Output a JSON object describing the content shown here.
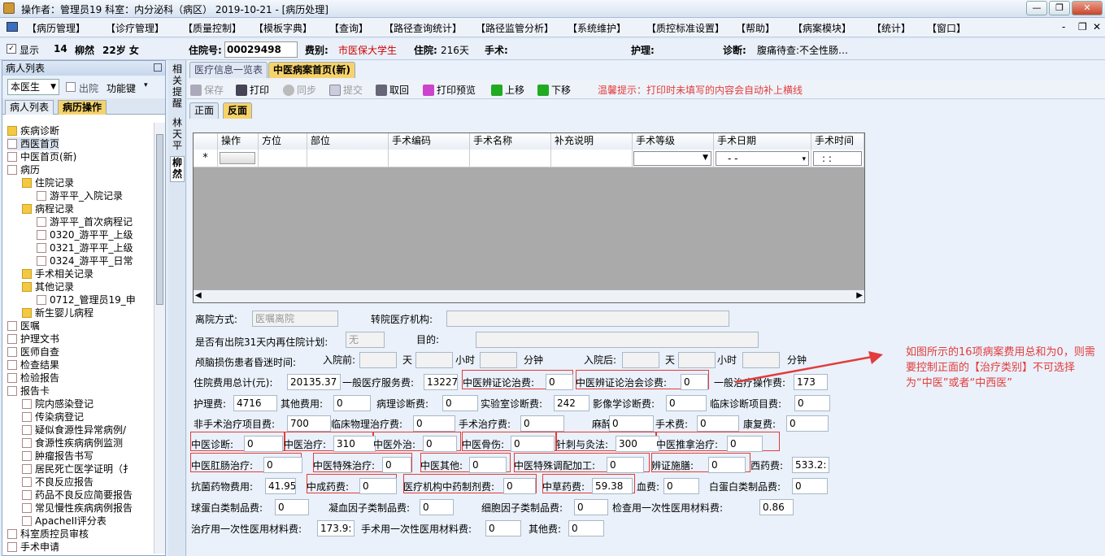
{
  "titlebar": {
    "text": "操作者：管理员19  科室：内分泌科（病区）  2019-10-21 - [病历处理]",
    "minimize": "—",
    "restore": "❐",
    "close": "✕"
  },
  "menu": [
    "【病历管理】",
    "【诊疗管理】",
    "【质量控制】",
    "【模板字典】",
    "【查询】",
    "【路径查询统计】",
    "【路径监管分析】",
    "【系统维护】",
    "【质控标准设置】",
    "【帮助】",
    "【病案模块】",
    "【统计】",
    "【窗口】"
  ],
  "menu_right": {
    "min": "-",
    "restore": "❐",
    "close": "✕"
  },
  "patient": {
    "show_label": "显示",
    "bed": "14",
    "name": "柳然",
    "age_sex": "22岁 女",
    "inpatient_no_label": "住院号:",
    "inpatient_no": "00029498",
    "fee_type_label": "费别:",
    "fee_type": "市医保大学生",
    "stay_label": "住院:",
    "stay": "216天",
    "surgery_label": "手术:",
    "nursing_label": "护理:",
    "diagnosis_label": "诊断:",
    "diagnosis": "腹痛待查:不全性肠…"
  },
  "left_panel": {
    "title": "病人列表",
    "doctor_select": "本医生",
    "discharge_label": "出院",
    "function_key": "功能键",
    "tabs": [
      "病人列表",
      "病历操作"
    ],
    "tree": [
      {
        "label": "疾病诊断",
        "level": 1
      },
      {
        "label": "西医首页",
        "level": 1
      },
      {
        "label": "中医首页(新)",
        "level": 1
      },
      {
        "label": "病历",
        "level": 1
      },
      {
        "label": "住院记录",
        "level": 2
      },
      {
        "label": "游平平_入院记录",
        "level": 3
      },
      {
        "label": "病程记录",
        "level": 2
      },
      {
        "label": "游平平_首次病程记",
        "level": 3
      },
      {
        "label": "0320_游平平_上级",
        "level": 3
      },
      {
        "label": "0321_游平平_上级",
        "level": 3
      },
      {
        "label": "0324_游平平_日常",
        "level": 3
      },
      {
        "label": "手术相关记录",
        "level": 2
      },
      {
        "label": "其他记录",
        "level": 2
      },
      {
        "label": "0712_管理员19_申",
        "level": 3
      },
      {
        "label": "新生婴儿病程",
        "level": 2
      },
      {
        "label": "医嘱",
        "level": 1
      },
      {
        "label": "护理文书",
        "level": 1
      },
      {
        "label": "医师自查",
        "level": 1
      },
      {
        "label": "检查结果",
        "level": 1
      },
      {
        "label": "检验报告",
        "level": 1
      },
      {
        "label": "报告卡",
        "level": 1
      },
      {
        "label": "院内感染登记",
        "level": 2
      },
      {
        "label": "传染病登记",
        "level": 2
      },
      {
        "label": "疑似食源性异常病例/",
        "level": 2
      },
      {
        "label": "食源性疾病病例监测",
        "level": 2
      },
      {
        "label": "肿瘤报告书写",
        "level": 2
      },
      {
        "label": "居民死亡医学证明（扌",
        "level": 2
      },
      {
        "label": "不良反应报告",
        "level": 2
      },
      {
        "label": "药品不良反应简要报告",
        "level": 2
      },
      {
        "label": "常见慢性疾病病例报告",
        "level": 2
      },
      {
        "label": "ApacheII评分表",
        "level": 2
      },
      {
        "label": "科室质控员审核",
        "level": 1
      },
      {
        "label": "手术申请",
        "level": 1
      }
    ]
  },
  "side_strip": [
    "相关提醒",
    "林天平",
    "柳然"
  ],
  "main_tabs": [
    "医疗信息一览表",
    "中医病案首页(新)"
  ],
  "toolbar": {
    "save": "保存",
    "print": "打印",
    "sync": "同步",
    "submit": "提交",
    "retrieve": "取回",
    "print_preview": "打印预览",
    "move_up": "上移",
    "move_down": "下移",
    "tip": "温馨提示：打印时未填写的内容会自动补上横线"
  },
  "sub_tabs": [
    "正面",
    "反面"
  ],
  "grid": {
    "columns": [
      "操作",
      "方位",
      "部位",
      "手术编码",
      "手术名称",
      "补充说明",
      "手术等级",
      "手术日期",
      "手术时间"
    ],
    "row_marker": "*",
    "date_placeholder": "-    -",
    "time_placeholder": ":    :"
  },
  "form": {
    "discharge_method_label": "离院方式:",
    "discharge_method": "医嘱离院",
    "transfer_org_label": "转院医疗机构:",
    "readmit_label": "是否有出院31天内再住院计划:",
    "readmit": "无",
    "purpose_label": "目的:",
    "coma_label": "颅脑损伤患者昏迷时间:",
    "before_label": "入院前:",
    "after_label": "入院后:",
    "day": "天",
    "hour": "小时",
    "minute": "分钟",
    "total_label": "住院费用总计(元):",
    "total": "20135.37",
    "fees": [
      {
        "label": "一般医疗服务费:",
        "value": "13227"
      },
      {
        "label": "中医辨证论治费:",
        "value": "0",
        "boxed": true
      },
      {
        "label": "中医辨证论治会诊费:",
        "value": "0",
        "boxed": true
      },
      {
        "label": "一般治疗操作费:",
        "value": "173"
      },
      {
        "label": "护理费:",
        "value": "4716"
      },
      {
        "label": "其他费用:",
        "value": "0"
      },
      {
        "label": "病理诊断费:",
        "value": "0"
      },
      {
        "label": "实验室诊断费:",
        "value": "242"
      },
      {
        "label": "影像学诊断费:",
        "value": "0"
      },
      {
        "label": "临床诊断项目费:",
        "value": "0"
      },
      {
        "label": "非手术治疗项目费:",
        "value": "700"
      },
      {
        "label": "临床物理治疗费:",
        "value": "0"
      },
      {
        "label": "手术治疗费:",
        "value": "0"
      },
      {
        "label": "麻醉费:",
        "value": "0"
      },
      {
        "label": "手术费:",
        "value": "0"
      },
      {
        "label": "康复费:",
        "value": "0"
      },
      {
        "label": "中医诊断:",
        "value": "0",
        "boxed": true
      },
      {
        "label": "中医治疗:",
        "value": "310",
        "boxed": true
      },
      {
        "label": "中医外治:",
        "value": "0",
        "boxed": true
      },
      {
        "label": "中医骨伤:",
        "value": "0",
        "boxed": true
      },
      {
        "label": "针刺与灸法:",
        "value": "300",
        "boxed": true
      },
      {
        "label": "中医推拿治疗:",
        "value": "0",
        "boxed": true
      },
      {
        "label": "中医肛肠治疗:",
        "value": "0",
        "boxed": true
      },
      {
        "label": "中医特殊治疗:",
        "value": "0",
        "boxed": true
      },
      {
        "label": "中医其他:",
        "value": "0",
        "boxed": true
      },
      {
        "label": "中医特殊调配加工:",
        "value": "0",
        "boxed": true
      },
      {
        "label": "辨证施膳:",
        "value": "0",
        "boxed": true
      },
      {
        "label": "西药费:",
        "value": "533.2:"
      },
      {
        "label": "抗菌药物费用:",
        "value": "41.95"
      },
      {
        "label": "中成药费:",
        "value": "0",
        "boxed": true
      },
      {
        "label": "医疗机构中药制剂费:",
        "value": "0",
        "boxed": true
      },
      {
        "label": "中草药费:",
        "value": "59.38",
        "boxed": true
      },
      {
        "label": "血费:",
        "value": "0"
      },
      {
        "label": "白蛋白类制品费:",
        "value": "0"
      },
      {
        "label": "球蛋白类制品费:",
        "value": "0"
      },
      {
        "label": "凝血因子类制品费:",
        "value": "0"
      },
      {
        "label": "细胞因子类制品费:",
        "value": "0"
      },
      {
        "label": "检查用一次性医用材料费:",
        "value": "0.86"
      },
      {
        "label": "治疗用一次性医用材料费:",
        "value": "173.9:"
      },
      {
        "label": "手术用一次性医用材料费:",
        "value": "0"
      },
      {
        "label": "其他费:",
        "value": "0"
      }
    ]
  },
  "annotation": "如图所示的16项病案费用总和为0，则需要控制正面的【治疗类别】不可选择为“中医”或者“中西医”",
  "colors": {
    "red_accent": "#e23c3c",
    "panel_bg": "#eaf1fa",
    "fee_type": "#d00000"
  }
}
